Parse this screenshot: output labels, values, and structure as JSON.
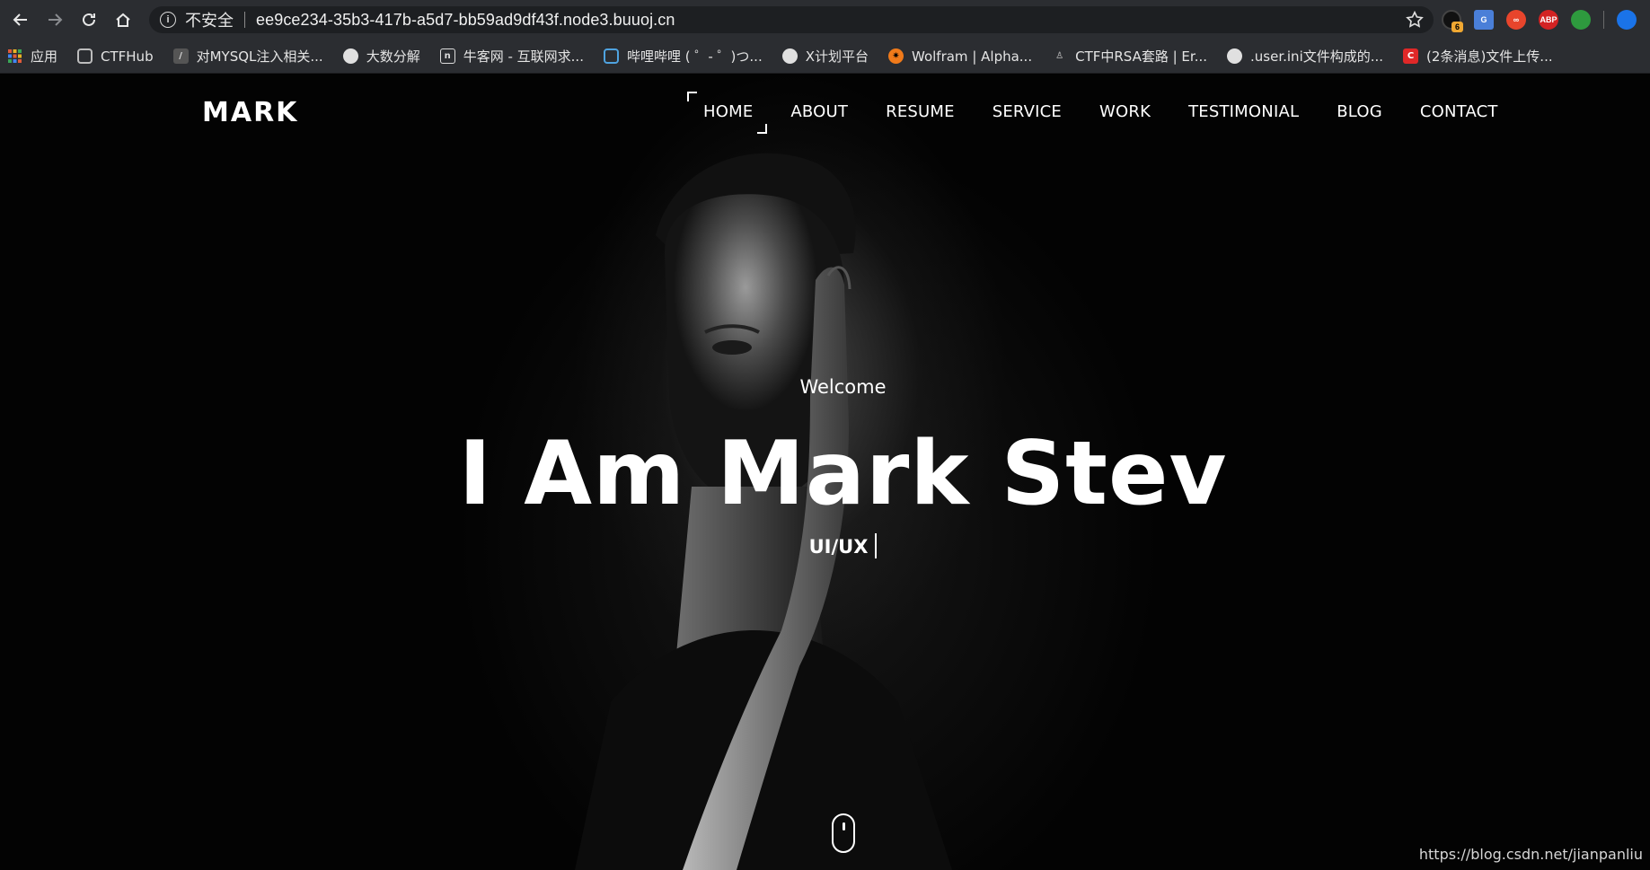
{
  "browser": {
    "insecure_label": "不安全",
    "url": "ee9ce234-35b3-417b-a5d7-bb59ad9df43f.node3.buuoj.cn",
    "extension_badge": "6",
    "abp_label": "ABP",
    "bookmarks": [
      {
        "label": "应用",
        "icon": "apps-grid-icon",
        "color": "#e05a3a"
      },
      {
        "label": "CTFHub",
        "icon": "ctfhub-icon",
        "color": "#bdbdbd"
      },
      {
        "label": "对MYSQL注入相关...",
        "icon": "mysql-icon",
        "color": "#9e9e9e"
      },
      {
        "label": "大数分解",
        "icon": "globe-icon",
        "color": "#e0e0e0"
      },
      {
        "label": "牛客网 - 互联网求...",
        "icon": "nowcoder-icon",
        "color": "#e0e0e0"
      },
      {
        "label": "哔哩哔哩 ( ゜- ゜)つ...",
        "icon": "bilibili-icon",
        "color": "#4fa3e0"
      },
      {
        "label": "X计划平台",
        "icon": "globe-icon",
        "color": "#e0e0e0"
      },
      {
        "label": "Wolfram | Alpha...",
        "icon": "wolfram-icon",
        "color": "#f07a1a"
      },
      {
        "label": "CTF中RSA套路 | Er...",
        "icon": "person-icon",
        "color": "#cfcfcf"
      },
      {
        "label": ".user.ini文件构成的...",
        "icon": "globe-icon",
        "color": "#e0e0e0"
      },
      {
        "label": "(2条消息)文件上传...",
        "icon": "csdn-icon",
        "color": "#e02828"
      }
    ]
  },
  "site": {
    "logo": "MARK",
    "nav": [
      "HOME",
      "ABOUT",
      "RESUME",
      "SERVICE",
      "WORK",
      "TESTIMONIAL",
      "BLOG",
      "CONTACT"
    ],
    "active_nav": "HOME",
    "welcome": "Welcome",
    "headline": "I Am Mark Stev",
    "subtitle": "UI/UX"
  },
  "watermark": "https://blog.csdn.net/jianpanliu"
}
